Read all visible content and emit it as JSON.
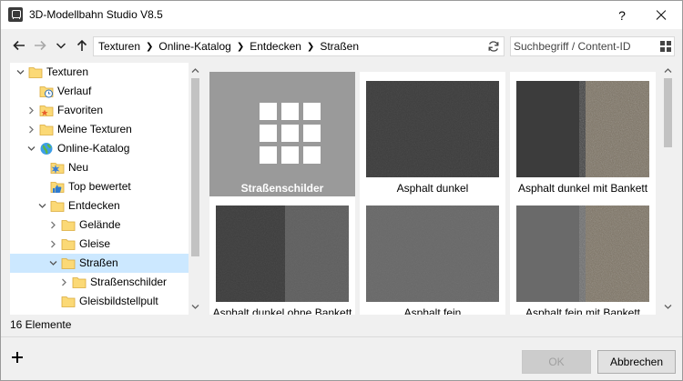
{
  "window": {
    "title": "3D-Modellbahn Studio V8.5",
    "help_label": "?",
    "close_label": ""
  },
  "nav": {
    "breadcrumbs": [
      "Texturen",
      "Online-Katalog",
      "Entdecken",
      "Straßen"
    ],
    "search_placeholder": "Suchbegriff / Content-ID"
  },
  "tree": {
    "items": [
      {
        "label": "Texturen",
        "level": 0,
        "expander": "open",
        "icon": "folder-icon"
      },
      {
        "label": "Verlauf",
        "level": 1,
        "expander": "none",
        "icon": "history-icon"
      },
      {
        "label": "Favoriten",
        "level": 1,
        "expander": "closed",
        "icon": "star-folder-icon"
      },
      {
        "label": "Meine Texturen",
        "level": 1,
        "expander": "closed",
        "icon": "folder-icon"
      },
      {
        "label": "Online-Katalog",
        "level": 1,
        "expander": "open",
        "icon": "globe-icon"
      },
      {
        "label": "Neu",
        "level": 2,
        "expander": "none",
        "icon": "new-star-icon"
      },
      {
        "label": "Top bewertet",
        "level": 2,
        "expander": "none",
        "icon": "thumbs-up-icon"
      },
      {
        "label": "Entdecken",
        "level": 2,
        "expander": "open",
        "icon": "folder-icon"
      },
      {
        "label": "Gelände",
        "level": 3,
        "expander": "closed",
        "icon": "folder-icon"
      },
      {
        "label": "Gleise",
        "level": 3,
        "expander": "closed",
        "icon": "folder-icon"
      },
      {
        "label": "Straßen",
        "level": 3,
        "expander": "open",
        "icon": "folder-icon",
        "selected": true
      },
      {
        "label": "Straßenschilder",
        "level": 4,
        "expander": "closed",
        "icon": "folder-icon"
      },
      {
        "label": "Gleisbildstellpult",
        "level": 3,
        "expander": "none",
        "icon": "folder-icon"
      }
    ]
  },
  "grid": {
    "tiles": [
      {
        "label": "Straßenschilder",
        "kind": "folder",
        "selected": true
      },
      {
        "label": "Asphalt dunkel",
        "kind": "texture"
      },
      {
        "label": "Asphalt dunkel mit Bankett",
        "kind": "texture"
      },
      {
        "label": "Asphalt dunkel ohne Bankett",
        "kind": "texture"
      },
      {
        "label": "Asphalt fein",
        "kind": "texture"
      },
      {
        "label": "Asphalt fein mit Bankett",
        "kind": "texture"
      }
    ]
  },
  "status": {
    "count_text": "16 Elemente"
  },
  "footer": {
    "ok_label": "OK",
    "cancel_label": "Abbrechen"
  },
  "colors": {
    "selection": "#cce8ff",
    "folder": "#fbd976",
    "selected_tile": "#9a9a9a"
  }
}
